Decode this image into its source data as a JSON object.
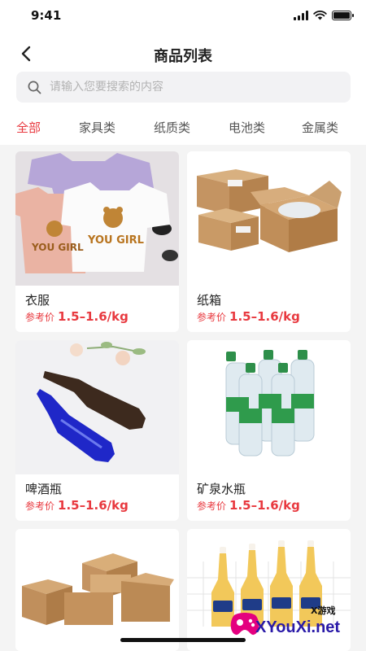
{
  "status_bar": {
    "time": "9:41"
  },
  "header": {
    "title": "商品列表"
  },
  "search": {
    "placeholder": "请输入您要搜索的内容"
  },
  "tabs": [
    {
      "label": "全部",
      "active": true
    },
    {
      "label": "家具类",
      "active": false
    },
    {
      "label": "纸质类",
      "active": false
    },
    {
      "label": "电池类",
      "active": false
    },
    {
      "label": "金属类",
      "active": false
    }
  ],
  "products": [
    {
      "name": "衣服",
      "price_label": "参考价",
      "price": "1.5–1.6/kg"
    },
    {
      "name": "纸箱",
      "price_label": "参考价",
      "price": "1.5–1.6/kg"
    },
    {
      "name": "啤酒瓶",
      "price_label": "参考价",
      "price": "1.5–1.6/kg"
    },
    {
      "name": "矿泉水瓶",
      "price_label": "参考价",
      "price": "1.5–1.6/kg"
    },
    {
      "name": "",
      "price_label": "",
      "price": ""
    },
    {
      "name": "",
      "price_label": "",
      "price": ""
    }
  ],
  "watermark": {
    "site": "XYouXi.net",
    "tag": "X游戏"
  },
  "colors": {
    "accent": "#e8393f",
    "background": "#f4f4f4",
    "card": "#ffffff"
  }
}
